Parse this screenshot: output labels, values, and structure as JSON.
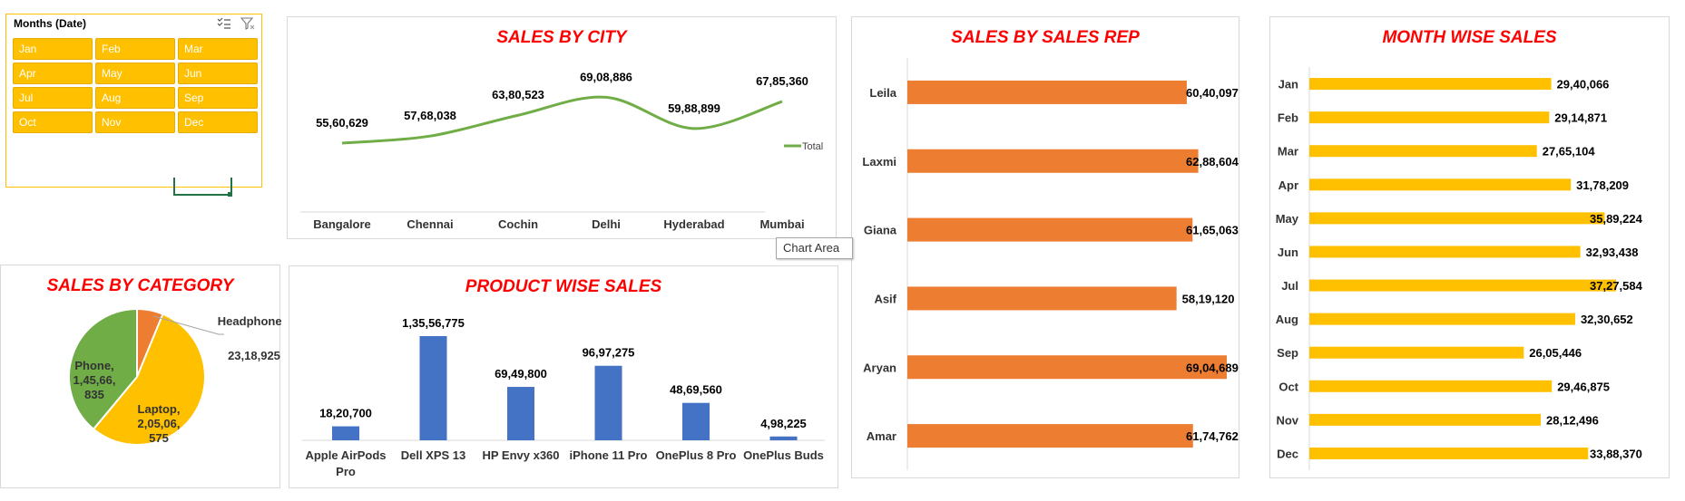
{
  "slicer": {
    "title": "Months (Date)",
    "months": [
      "Jan",
      "Feb",
      "Mar",
      "Apr",
      "May",
      "Jun",
      "Jul",
      "Aug",
      "Sep",
      "Oct",
      "Nov",
      "Dec"
    ],
    "accent": "#ffc000"
  },
  "tooltip": "Chart Area",
  "colors": {
    "title": "#ff0000",
    "line": "#70ad47",
    "bar_blue": "#4472c4",
    "bar_orange": "#ed7d31",
    "bar_gold": "#ffc000"
  },
  "chart_data": [
    {
      "id": "city",
      "type": "line",
      "title": "SALES BY CITY",
      "categories": [
        "Bangalore",
        "Chennai",
        "Cochin",
        "Delhi",
        "Hyderabad",
        "Mumbai"
      ],
      "series": [
        {
          "name": "Total",
          "values": [
            5560629,
            5768038,
            6380523,
            6908886,
            5988899,
            6785360
          ]
        }
      ],
      "data_labels": [
        "55,60,629",
        "57,68,038",
        "63,80,523",
        "69,08,886",
        "59,88,899",
        "67,85,360"
      ],
      "legend": "right",
      "grid": false
    },
    {
      "id": "rep",
      "type": "bar",
      "orientation": "horizontal",
      "title": "SALES BY SALES REP",
      "categories": [
        "Leila",
        "Laxmi",
        "Giana",
        "Asif",
        "Aryan",
        "Amar"
      ],
      "values": [
        6040097,
        6288604,
        6165063,
        5819120,
        6904689,
        6174762
      ],
      "data_labels": [
        "60,40,097",
        "62,88,604",
        "61,65,063",
        "58,19,120",
        "69,04,689",
        "61,74,762"
      ],
      "grid": false
    },
    {
      "id": "month",
      "type": "bar",
      "orientation": "horizontal",
      "title": "MONTH WISE SALES",
      "categories": [
        "Jan",
        "Feb",
        "Mar",
        "Apr",
        "May",
        "Jun",
        "Jul",
        "Aug",
        "Sep",
        "Oct",
        "Nov",
        "Dec"
      ],
      "values": [
        2940066,
        2914871,
        2765104,
        3178209,
        3589224,
        3293438,
        3727584,
        3230652,
        2605446,
        2946875,
        2812496,
        3388370
      ],
      "data_labels": [
        "29,40,066",
        "29,14,871",
        "27,65,104",
        "31,78,209",
        "35,89,224",
        "32,93,438",
        "37,27,584",
        "32,30,652",
        "26,05,446",
        "29,46,875",
        "28,12,496",
        "33,88,370"
      ],
      "grid": false
    },
    {
      "id": "category",
      "type": "pie",
      "title": "SALES BY CATEGORY",
      "categories": [
        "Headphone",
        "Laptop",
        "Phone"
      ],
      "values": [
        2318925,
        20506575,
        14566835
      ],
      "data_labels": [
        "Headphone, 23,18,925",
        "Laptop, 2,05,06, 575",
        "Phone, 1,45,66, 835"
      ],
      "colors": [
        "#ed7d31",
        "#ffc000",
        "#70ad47"
      ]
    },
    {
      "id": "product",
      "type": "bar",
      "title": "PRODUCT WISE SALES",
      "categories": [
        "Apple AirPods Pro",
        "Dell XPS 13",
        "HP Envy x360",
        "iPhone 11 Pro",
        "OnePlus 8 Pro",
        "OnePlus Buds"
      ],
      "values": [
        1820700,
        13556775,
        6949800,
        9697275,
        4869560,
        498225
      ],
      "data_labels": [
        "18,20,700",
        "1,35,56,775",
        "69,49,800",
        "96,97,275",
        "48,69,560",
        "4,98,225"
      ],
      "grid": false
    }
  ]
}
